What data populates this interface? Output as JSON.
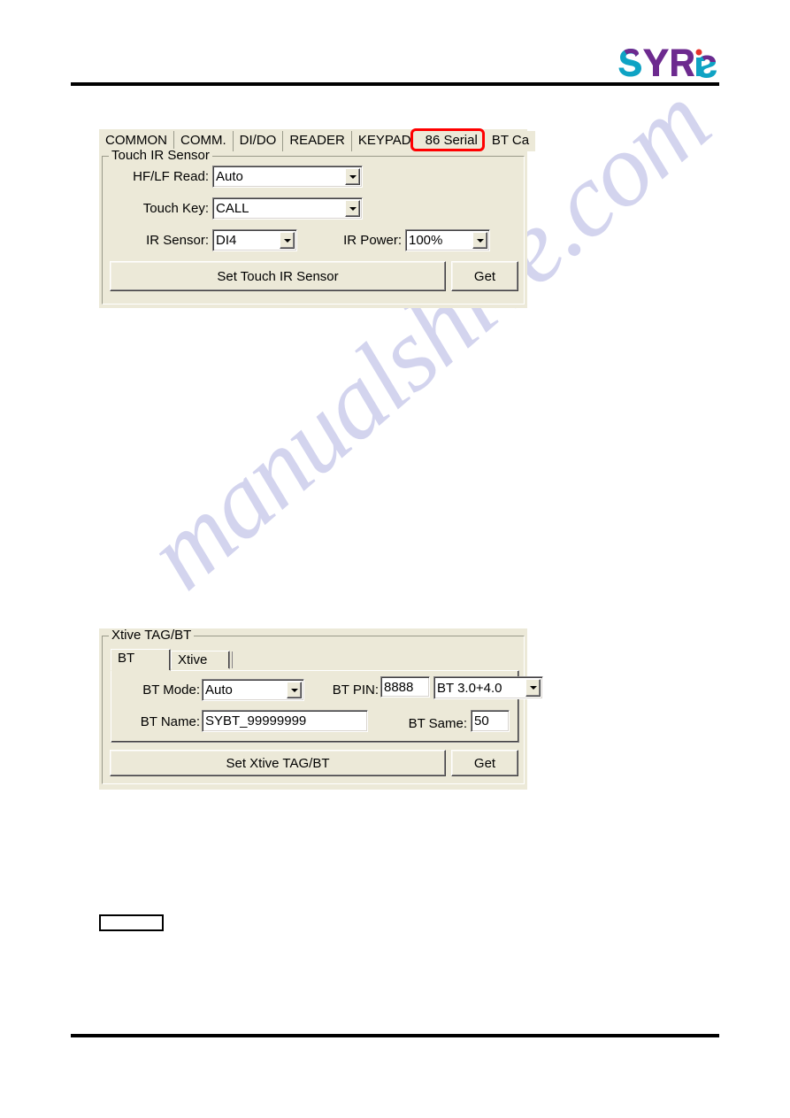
{
  "header": {
    "logo_text": "SYRIS",
    "logo_alt": "syris-logo",
    "logo_colors": {
      "purple": "#6d2a8f",
      "teal": "#0fa3c4",
      "red_dot": "#e8322a"
    },
    "rule_color": "#000000"
  },
  "watermark": {
    "text": "manualshive.com",
    "color": "#b9bbe4"
  },
  "touch_ir_panel": {
    "tabs": [
      {
        "label": "COMMON",
        "selected": false
      },
      {
        "label": "COMM.",
        "selected": false
      },
      {
        "label": "DI/DO",
        "selected": false
      },
      {
        "label": "READER",
        "selected": false
      },
      {
        "label": "KEYPAD",
        "selected": false
      },
      {
        "label": "86 Serial",
        "selected": true
      },
      {
        "label": "BT Ca",
        "selected": false
      }
    ],
    "highlight_color": "#ff0000",
    "group_title": "Touch IR Sensor",
    "fields": {
      "hf_lf_read_label": "HF/LF Read:",
      "hf_lf_read_value": "Auto",
      "touch_key_label": "Touch Key:",
      "touch_key_value": "CALL",
      "ir_sensor_label": "IR Sensor:",
      "ir_sensor_value": "DI4",
      "ir_power_label": "IR Power:",
      "ir_power_value": "100%"
    },
    "buttons": {
      "set_label": "Set Touch IR Sensor",
      "get_label": "Get"
    }
  },
  "xtive_panel": {
    "group_title": "Xtive TAG/BT",
    "tabs": [
      {
        "label": "BT",
        "selected": true
      },
      {
        "label": "Xtive",
        "selected": false
      }
    ],
    "fields": {
      "bt_mode_label": "BT Mode:",
      "bt_mode_value": "Auto",
      "bt_pin_label": "BT PIN:",
      "bt_pin_value": "8888",
      "bt_version_value": "BT 3.0+4.0",
      "bt_name_label": "BT Name:",
      "bt_name_value": "SYBT_99999999",
      "bt_same_label": "BT Same:",
      "bt_same_value": "50"
    },
    "buttons": {
      "set_label": "Set Xtive TAG/BT",
      "get_label": "Get"
    }
  },
  "stray_box": {
    "value": ""
  }
}
